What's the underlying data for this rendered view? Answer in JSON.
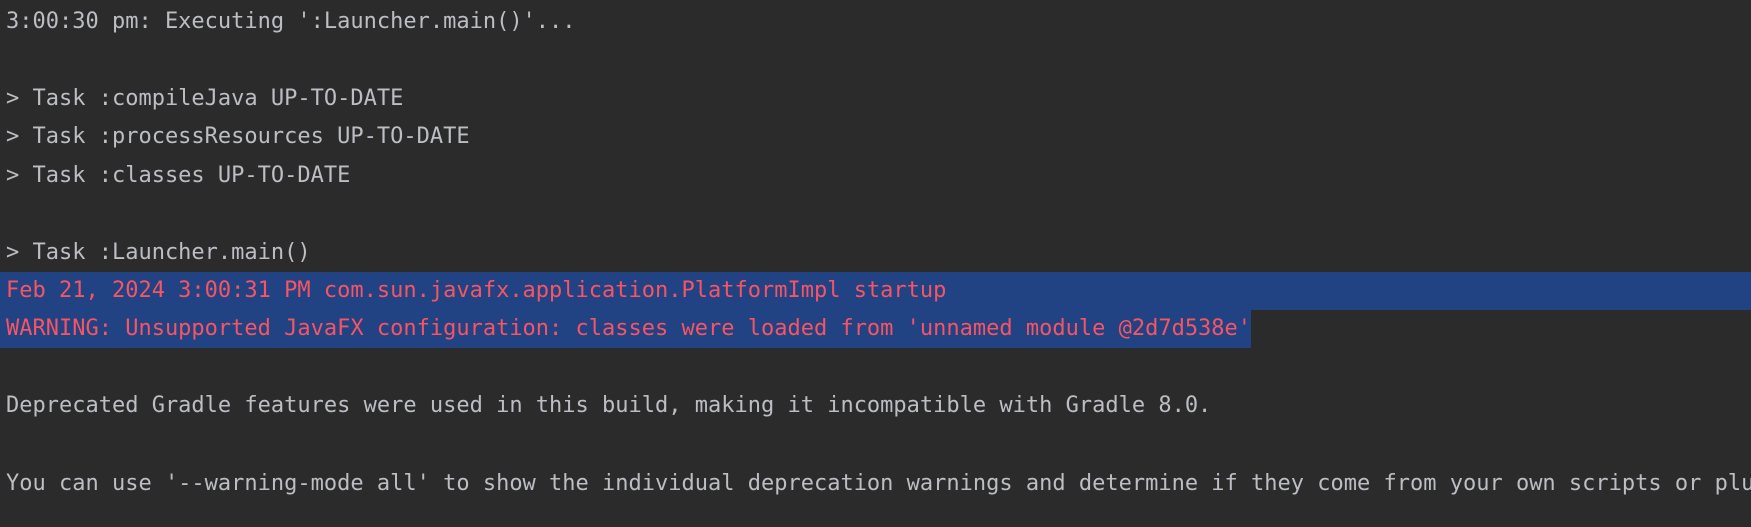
{
  "console": {
    "lines": [
      "3:00:30 pm: Executing ':Launcher.main()'...",
      "> Task :compileJava UP-TO-DATE",
      "> Task :processResources UP-TO-DATE",
      "> Task :classes UP-TO-DATE",
      "> Task :Launcher.main()",
      "Feb 21, 2024 3:00:31 PM com.sun.javafx.application.PlatformImpl startup",
      "WARNING: Unsupported JavaFX configuration: classes were loaded from 'unnamed module @2d7d538e'",
      "Deprecated Gradle features were used in this build, making it incompatible with Gradle 8.0.",
      "You can use '--warning-mode all' to show the individual deprecation warnings and determine if they come from your own scripts or plugins."
    ]
  },
  "colors": {
    "background": "#2b2b2b",
    "text": "#bcbec4",
    "error_text": "#f75464",
    "selection": "#214283"
  }
}
